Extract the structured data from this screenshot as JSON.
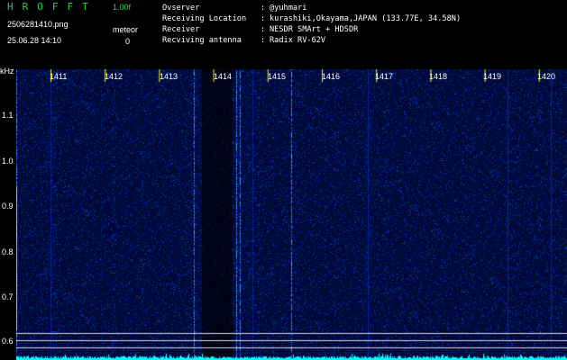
{
  "app": {
    "title": "HROFFT",
    "version": "1.00f"
  },
  "file_name": "2506281410.png",
  "timestamp": "25.06.28 14:10",
  "meteor": {
    "label": "meteor",
    "count": "0"
  },
  "info": [
    {
      "key": "Ovserver",
      "value": "@yuhmari"
    },
    {
      "key": "Receiving Location",
      "value": "kurashiki,Okayama,JAPAN (133.77E, 34.58N)"
    },
    {
      "key": "Receiver",
      "value": "NESDR SMArt + HDSDR"
    },
    {
      "key": "Recviving antenna",
      "value": "Radix RV-62V"
    }
  ],
  "spectrogram": {
    "unit": "kHz",
    "freq_ticks": [
      "1411",
      "1412",
      "1413",
      "1414",
      "1415",
      "1416",
      "1417",
      "1418",
      "1419",
      "1420"
    ],
    "y_ticks": [
      "1.1",
      "1.0",
      "0.9",
      "0.8",
      "0.7",
      "0.6"
    ]
  },
  "colors": {
    "background": "#000000",
    "waterfall": "#0a1a7a",
    "title_green": "#29d14a",
    "trace": "#00ffff",
    "tick_yellow": "#ffff00"
  }
}
